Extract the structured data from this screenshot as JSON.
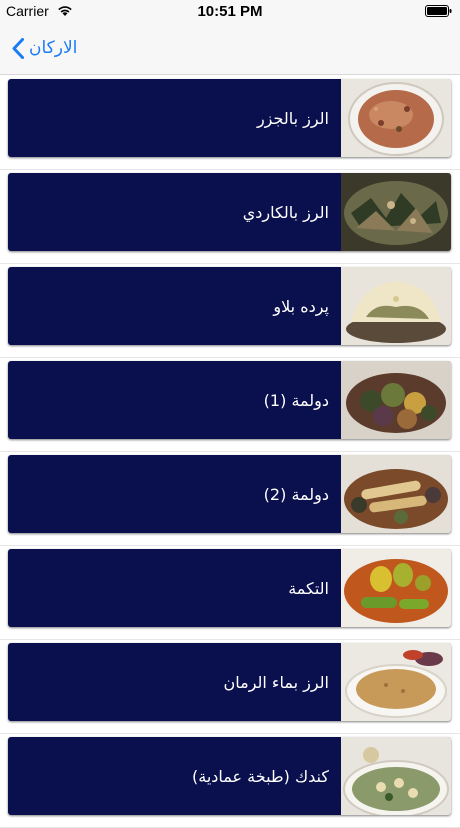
{
  "status_bar": {
    "carrier": "Carrier",
    "time": "10:51 PM"
  },
  "nav": {
    "back_label": "الاركان"
  },
  "items": [
    {
      "title": "الرز بالجزر",
      "image": "carrot-rice-photo"
    },
    {
      "title": "الرز بالكاردي",
      "image": "cardamom-rice-photo"
    },
    {
      "title": "پرده بلاو",
      "image": "pardeh-plov-photo"
    },
    {
      "title": "دولمة (1)",
      "image": "dolma-photo"
    },
    {
      "title": "دولمة (2)",
      "image": "dolma-rolls-photo"
    },
    {
      "title": "التكمة",
      "image": "stuffed-vegetables-photo"
    },
    {
      "title": "الرز بماء الرمان",
      "image": "pomegranate-rice-photo"
    },
    {
      "title": "كندك (طبخة عمادية)",
      "image": "kondak-stew-photo"
    }
  ],
  "colors": {
    "card_background": "#0a0f4d",
    "accent": "#1a7cf5",
    "bar_background": "#f7f7f7"
  }
}
